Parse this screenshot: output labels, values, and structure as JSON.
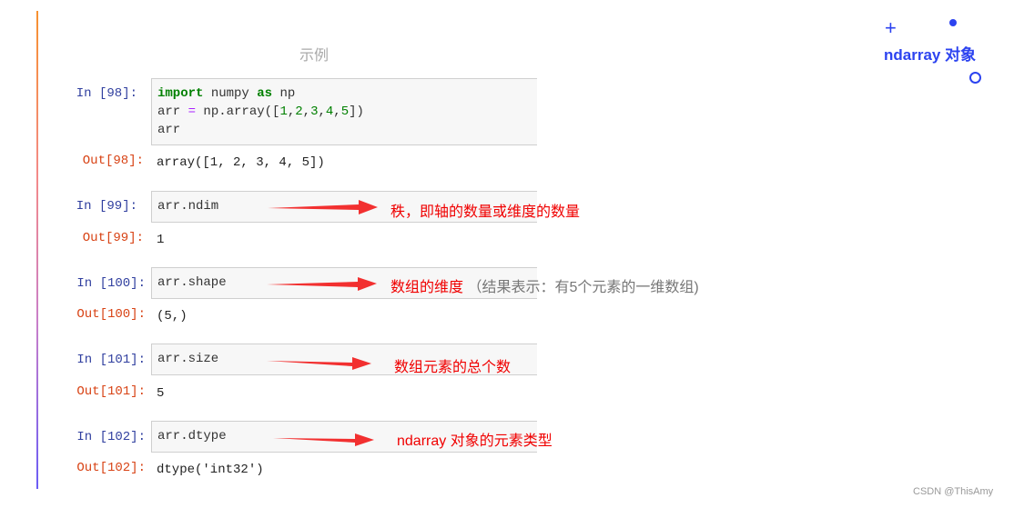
{
  "caption": "示例",
  "decoration": {
    "title": "ndarray 对象",
    "icons": [
      "plus-icon",
      "dot-icon",
      "ring-icon"
    ]
  },
  "cells": [
    {
      "in_prompt": "In  [98]:",
      "code_lines": [
        [
          {
            "t": "import",
            "c": "kw"
          },
          {
            "t": " numpy ",
            "c": ""
          },
          {
            "t": "as",
            "c": "kw"
          },
          {
            "t": " np",
            "c": ""
          }
        ],
        [
          {
            "t": "arr ",
            "c": ""
          },
          {
            "t": "=",
            "c": "op"
          },
          {
            "t": " np.array([",
            "c": ""
          },
          {
            "t": "1",
            "c": "num"
          },
          {
            "t": ",",
            "c": ""
          },
          {
            "t": "2",
            "c": "num"
          },
          {
            "t": ",",
            "c": ""
          },
          {
            "t": "3",
            "c": "num"
          },
          {
            "t": ",",
            "c": ""
          },
          {
            "t": "4",
            "c": "num"
          },
          {
            "t": ",",
            "c": ""
          },
          {
            "t": "5",
            "c": "num"
          },
          {
            "t": "])",
            "c": ""
          }
        ],
        [
          {
            "t": "arr",
            "c": ""
          }
        ]
      ],
      "out_prompt": "Out[98]:",
      "output": "array([1, 2, 3, 4, 5])",
      "annotation": "",
      "annotation_gray": ""
    },
    {
      "in_prompt": "In  [99]:",
      "code": "arr.ndim",
      "out_prompt": "Out[99]:",
      "output": "1",
      "annotation": "秩，即轴的数量或维度的数量",
      "annotation_gray": ""
    },
    {
      "in_prompt": "In  [100]:",
      "code": "arr.shape",
      "out_prompt": "Out[100]:",
      "output": "(5,)",
      "annotation": "数组的维度",
      "annotation_gray": "（结果表示：有5个元素的一维数组)"
    },
    {
      "in_prompt": "In  [101]:",
      "code": "arr.size",
      "out_prompt": "Out[101]:",
      "output": "5",
      "annotation": "数组元素的总个数",
      "annotation_gray": ""
    },
    {
      "in_prompt": "In  [102]:",
      "code": "arr.dtype",
      "out_prompt": "Out[102]:",
      "output": "dtype('int32')",
      "annotation": "ndarray 对象的元素类型",
      "annotation_gray": ""
    }
  ],
  "colors": {
    "in_prompt": "#303f9f",
    "out_prompt": "#d84315",
    "annotation": "#f00000",
    "arrow": "#f23030",
    "deco": "#2c43f0"
  },
  "watermark": "CSDN @ThisAmy"
}
